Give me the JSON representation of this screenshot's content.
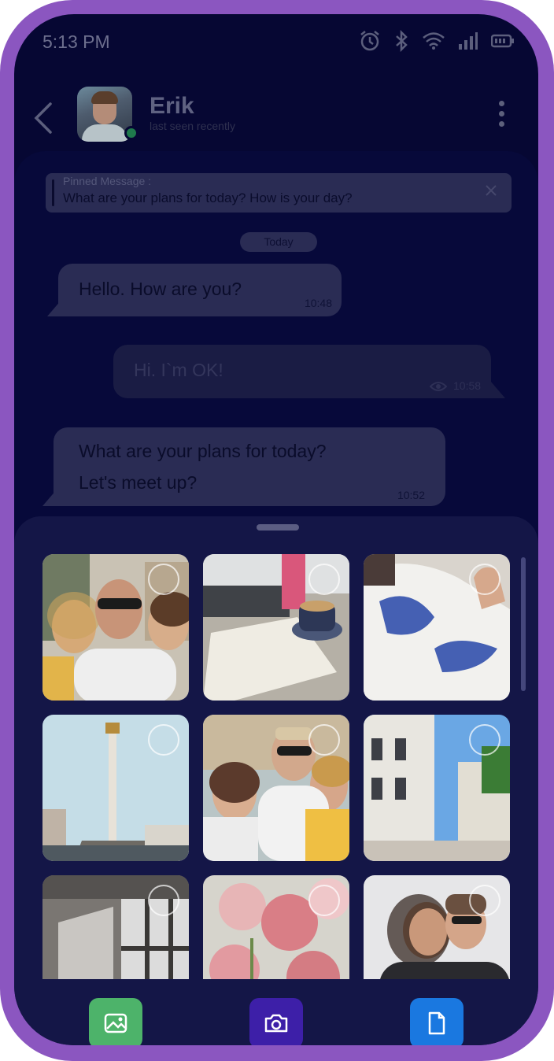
{
  "status_bar": {
    "time": "5:13 PM"
  },
  "header": {
    "name": "Erik",
    "status": "last seen recently"
  },
  "pinned": {
    "title": "Pinned Message :",
    "text": "What are your plans for today? How is your day?"
  },
  "date_divider": "Today",
  "messages": [
    {
      "lines": [
        "Hello. How are you?"
      ],
      "time": "10:48",
      "direction": "incoming"
    },
    {
      "lines": [
        "Hi. I`m OK!"
      ],
      "time": "10:58",
      "direction": "outgoing",
      "seen": true
    },
    {
      "lines": [
        "What are your plans for today?",
        "Let's meet up?"
      ],
      "time": "10:52",
      "direction": "incoming"
    }
  ],
  "gallery": {
    "photos": [
      {
        "subject": "group selfie with three friends"
      },
      {
        "subject": "laptop, notebook and coffee cup"
      },
      {
        "subject": "embroidered blouse"
      },
      {
        "subject": "independence monument column"
      },
      {
        "subject": "three friends smiling outdoors"
      },
      {
        "subject": "city street with white buildings"
      },
      {
        "subject": "sunlit window interior"
      },
      {
        "subject": "pink flowers"
      },
      {
        "subject": "two friends hugging"
      }
    ]
  },
  "actions": [
    {
      "name": "gallery",
      "color": "#4db36a"
    },
    {
      "name": "camera",
      "color": "#3d1fa8"
    },
    {
      "name": "file",
      "color": "#1a78e0"
    }
  ]
}
